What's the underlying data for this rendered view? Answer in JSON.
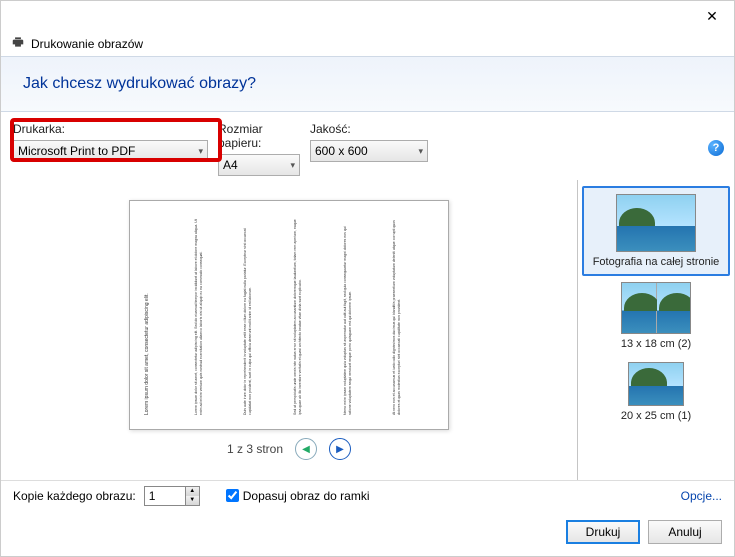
{
  "window": {
    "title": "Drukowanie obrazów"
  },
  "banner": {
    "heading": "Jak chcesz wydrukować obrazy?"
  },
  "controls": {
    "printer": {
      "label": "Drukarka:",
      "value": "Microsoft Print to PDF"
    },
    "paper": {
      "label": "Rozmiar papieru:",
      "value": "A4"
    },
    "quality": {
      "label": "Jakość:",
      "value": "600 x 600"
    }
  },
  "preview": {
    "page_text_title": "Lorem ipsum dolor sit amet, consectetur adipiscing elit.",
    "pager_status": "1 z 3 stron"
  },
  "templates": [
    {
      "label": "Fotografia na całej stronie",
      "style": "full",
      "selected": true
    },
    {
      "label": "13 x 18 cm (2)",
      "style": "half",
      "selected": false
    },
    {
      "label": "20 x 25 cm (1)",
      "style": "small",
      "selected": false
    }
  ],
  "bottom": {
    "copies_label": "Kopie każdego obrazu:",
    "copies_value": "1",
    "fit_label": "Dopasuj obraz do ramki",
    "fit_checked": true,
    "options_link": "Opcje..."
  },
  "footer": {
    "print": "Drukuj",
    "cancel": "Anuluj"
  }
}
